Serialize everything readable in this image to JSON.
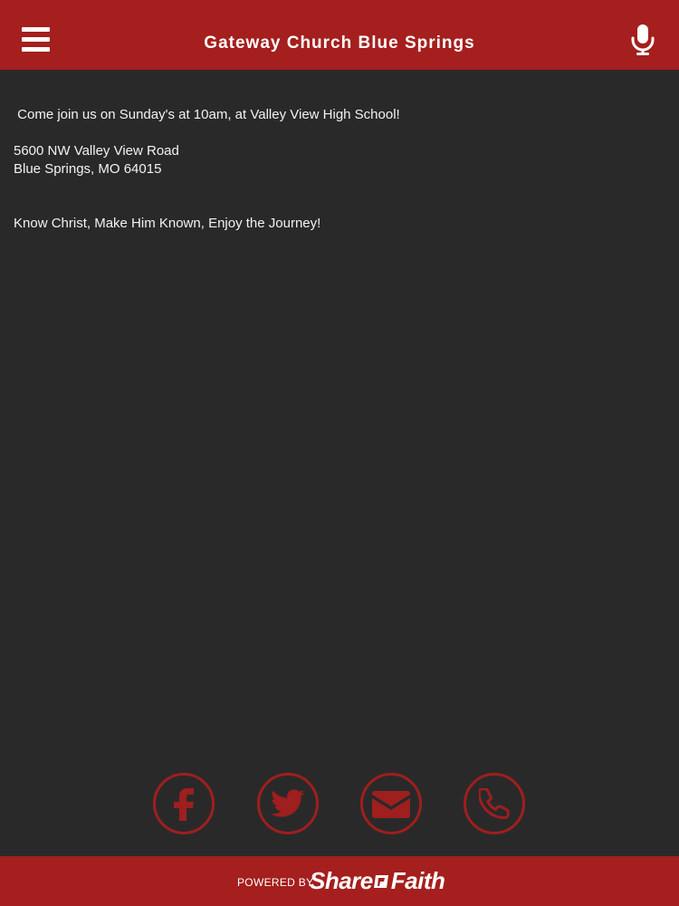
{
  "header": {
    "title": "Gateway Church Blue Springs",
    "menu_icon": "hamburger-menu-icon",
    "mic_icon": "microphone-icon"
  },
  "content": {
    "service_line": " Come join us on Sunday's at 10am, at Valley View High School!",
    "address_line1": "5600 NW Valley View Road",
    "address_line2": "Blue Springs, MO 64015",
    "motto": "Know Christ, Make Him Known, Enjoy the Journey!"
  },
  "social": [
    {
      "name": "facebook",
      "icon": "facebook-icon"
    },
    {
      "name": "twitter",
      "icon": "twitter-icon"
    },
    {
      "name": "email",
      "icon": "envelope-icon"
    },
    {
      "name": "phone",
      "icon": "phone-icon"
    }
  ],
  "footer": {
    "powered_by": "POWERED BY",
    "brand_part1": "Share",
    "brand_part2": "Faith"
  },
  "colors": {
    "brand_red": "#a41f1d",
    "background": "#2a292a",
    "icon_red": "#9e1f1d"
  }
}
